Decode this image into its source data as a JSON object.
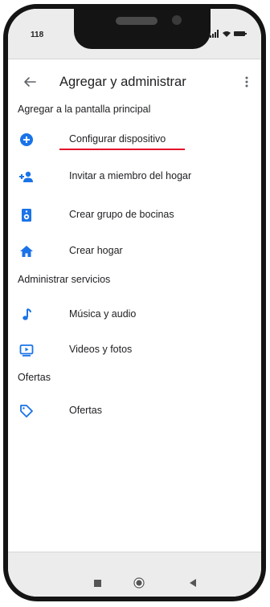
{
  "status_bar": {
    "time": "118"
  },
  "app_bar": {
    "title": "Agregar y administrar"
  },
  "sections": {
    "add": "Agregar a la pantalla principal",
    "manage": "Administrar servicios",
    "offers": "Ofertas"
  },
  "items": {
    "setup_device": "Configurar dispositivo",
    "invite_member": "Invitar a miembro del hogar",
    "speaker_group": "Crear grupo de bocinas",
    "create_home": "Crear hogar",
    "music_audio": "Música y audio",
    "videos_photos": "Videos y fotos",
    "offers": "Ofertas"
  },
  "icons": {
    "back": "arrow-back-icon",
    "more": "more-vert-icon",
    "setup_device": "add-circle-icon",
    "invite_member": "person-add-icon",
    "speaker_group": "speaker-icon",
    "create_home": "home-icon",
    "music_audio": "music-note-icon",
    "videos_photos": "video-library-icon",
    "offers": "tag-icon"
  },
  "colors": {
    "accent": "#1a73e8",
    "underline": "#e4102a",
    "text": "#202124"
  }
}
